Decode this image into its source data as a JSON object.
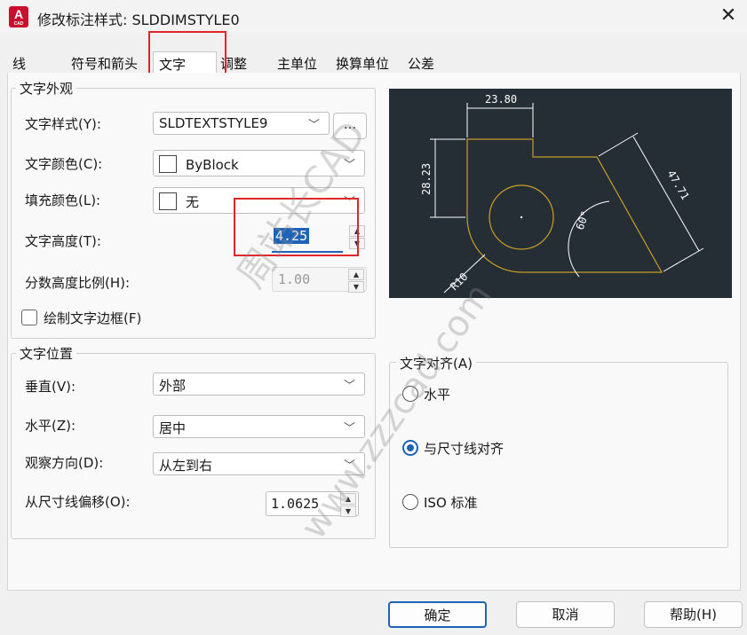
{
  "window": {
    "title": "修改标注样式: SLDDIMSTYLE0",
    "app_icon_letter": "A",
    "app_icon_caption": "CAD",
    "close": "✕"
  },
  "tabs": [
    "线",
    "符号和箭头",
    "文字",
    "调整",
    "主单位",
    "换算单位",
    "公差"
  ],
  "text_appearance": {
    "group_title": "文字外观",
    "style_label": "文字样式(Y):",
    "style_value": "SLDTEXTSTYLE9",
    "style_browse": "...",
    "color_label": "文字颜色(C):",
    "color_value": "ByBlock",
    "fill_label": "填充颜色(L):",
    "fill_value": "无",
    "height_label": "文字高度(T):",
    "height_value": "4.25",
    "fraction_label": "分数高度比例(H):",
    "fraction_value": "1.00",
    "frame_label": "绘制文字边框(F)"
  },
  "text_placement": {
    "group_title": "文字位置",
    "vertical_label": "垂直(V):",
    "vertical_value": "外部",
    "horizontal_label": "水平(Z):",
    "horizontal_value": "居中",
    "view_label": "观察方向(D):",
    "view_value": "从左到右",
    "offset_label": "从尺寸线偏移(O):",
    "offset_value": "1.0625"
  },
  "text_alignment": {
    "group_title": "文字对齐(A)",
    "options": [
      "水平",
      "与尺寸线对齐",
      "ISO 标准"
    ],
    "selected": "与尺寸线对齐"
  },
  "preview": {
    "dim_top": "23.80",
    "dim_left": "28.23",
    "dim_slant": "47.71",
    "dim_angle": "60°",
    "dim_radius": "R10"
  },
  "watermark": {
    "line1": "周站长CAD",
    "line2": "www.zzzcad.com"
  },
  "buttons": {
    "ok": "确定",
    "cancel": "取消",
    "help": "帮助(H)"
  },
  "colors": {
    "highlight": "#e0262a",
    "preview_bg": "#252d35",
    "preview_lines": "#c8a028",
    "selection": "#1f63b8"
  }
}
